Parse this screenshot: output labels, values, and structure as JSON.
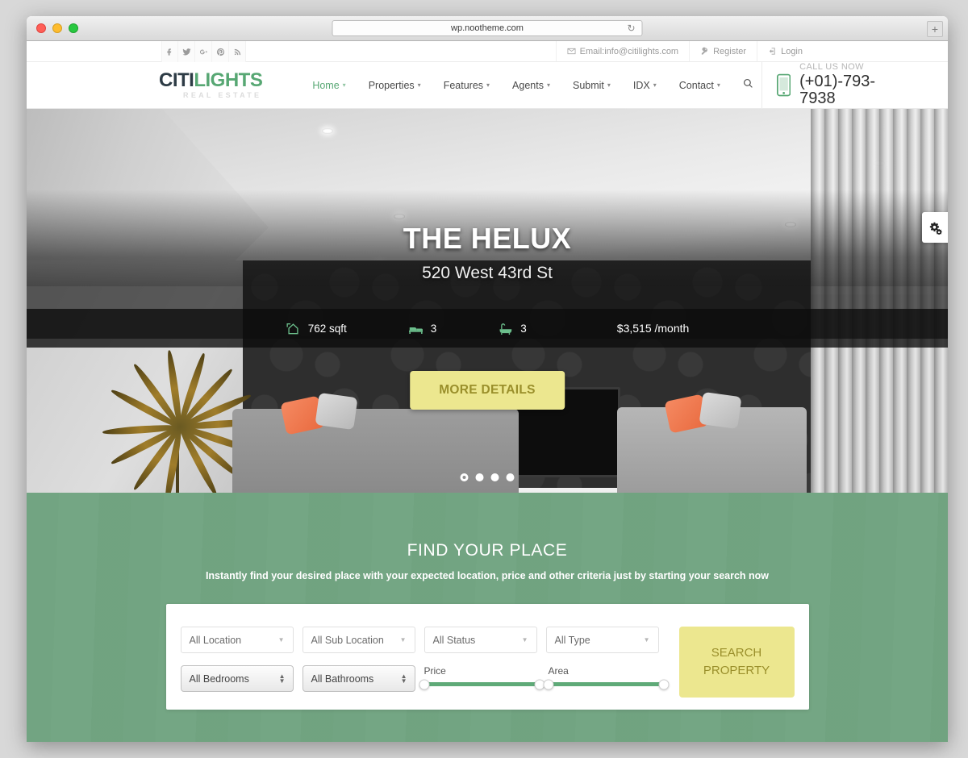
{
  "browser": {
    "url": "wp.nootheme.com",
    "reload_icon": "reload-icon",
    "newtab_label": "+"
  },
  "topbar": {
    "social": [
      {
        "name": "facebook-icon",
        "label": "f"
      },
      {
        "name": "twitter-icon",
        "label": "t"
      },
      {
        "name": "googleplus-icon",
        "label": "G+"
      },
      {
        "name": "pinterest-icon",
        "label": "P"
      },
      {
        "name": "rss-icon",
        "label": "rss"
      }
    ],
    "email": "Email:info@citilights.com",
    "register": "Register",
    "login": "Login"
  },
  "header": {
    "logo_primary": "CITI",
    "logo_secondary": "LIGHTS",
    "logo_tagline": "REAL ESTATE",
    "nav": [
      {
        "label": "Home",
        "active": true,
        "caret": "▾"
      },
      {
        "label": "Properties",
        "active": false,
        "caret": "▾"
      },
      {
        "label": "Features",
        "active": false,
        "caret": "▾"
      },
      {
        "label": "Agents",
        "active": false,
        "caret": "▾"
      },
      {
        "label": "Submit",
        "active": false,
        "caret": "▾"
      },
      {
        "label": "IDX",
        "active": false,
        "caret": "▾"
      },
      {
        "label": "Contact",
        "active": false,
        "caret": "▾"
      }
    ],
    "search_icon": "search-icon",
    "call_label": "CALL US NOW",
    "call_number": "(+01)-793-7938"
  },
  "hero": {
    "title": "THE HELUX",
    "address": "520 West 43rd St",
    "stats": [
      {
        "icon": "area-home-icon",
        "value": "762 sqft"
      },
      {
        "icon": "bed-icon",
        "value": "3"
      },
      {
        "icon": "bath-icon",
        "value": "3"
      }
    ],
    "price": "$3,515 /month",
    "cta": "MORE DETAILS",
    "slide_count": 4,
    "active_slide": 1,
    "settings_icon": "gears-icon"
  },
  "find": {
    "title": "FIND YOUR PLACE",
    "description": "Instantly find your desired place with your expected location, price and other criteria just by starting your search now",
    "filters_row1": [
      {
        "name": "location-select",
        "value": "All Location"
      },
      {
        "name": "sub-location-select",
        "value": "All Sub Location"
      },
      {
        "name": "status-select",
        "value": "All Status"
      },
      {
        "name": "type-select",
        "value": "All Type"
      }
    ],
    "filters_row2": [
      {
        "name": "bedrooms-select",
        "value": "All Bedrooms"
      },
      {
        "name": "bathrooms-select",
        "value": "All Bathrooms"
      }
    ],
    "sliders": [
      {
        "name": "price-slider",
        "label": "Price"
      },
      {
        "name": "area-slider",
        "label": "Area"
      }
    ],
    "search_button": "SEARCH\nPROPERTY",
    "search_button_line1": "SEARCH",
    "search_button_line2": "PROPERTY"
  },
  "colors": {
    "brand_green": "#57a773",
    "section_green": "#72a883",
    "accent_yellow": "#ece78f",
    "accent_yellow_text": "#9a8f2b",
    "logo_dark": "#2d3b45"
  }
}
